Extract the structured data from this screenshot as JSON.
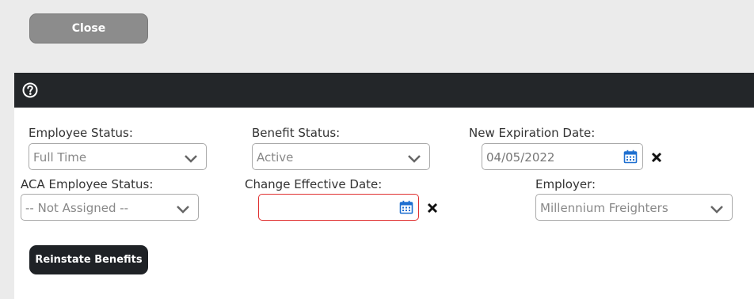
{
  "toolbar": {
    "close_label": "Close"
  },
  "icons": {
    "help": "question-circle-icon",
    "calendar": "calendar-icon",
    "clear": "x-icon",
    "dropdown": "chevron-down-icon"
  },
  "form": {
    "employee_status": {
      "label": "Employee Status:",
      "value": "Full Time"
    },
    "benefit_status": {
      "label": "Benefit Status:",
      "value": "Active"
    },
    "new_expiration_date": {
      "label": "New Expiration Date:",
      "value": "04/05/2022"
    },
    "aca_employee_status": {
      "label": "ACA Employee Status:",
      "value": "-- Not Assigned --"
    },
    "change_effective_date": {
      "label": "Change Effective Date:",
      "value": ""
    },
    "employer": {
      "label": "Employer:",
      "value": "Millennium Freighters"
    }
  },
  "actions": {
    "reinstate_label": "Reinstate Benefits"
  },
  "colors": {
    "header": "#232629",
    "invalid_border": "#e03030",
    "calendar": "#1e6fd0"
  }
}
